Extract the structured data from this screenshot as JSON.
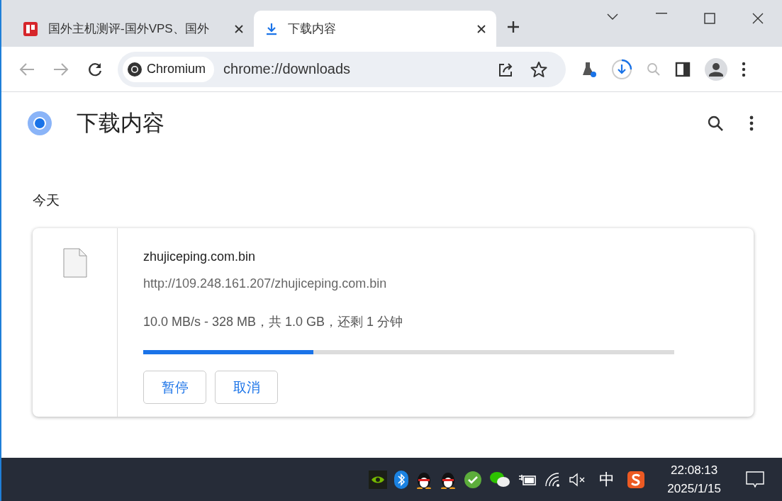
{
  "tabs": [
    {
      "title": "国外主机测评-国外VPS、国外",
      "selected": false,
      "kind": "site"
    },
    {
      "title": "下载内容",
      "selected": true,
      "kind": "download"
    }
  ],
  "toolbar": {
    "origin_chip": "Chromium",
    "url": "chrome://downloads"
  },
  "page": {
    "title": "下载内容",
    "section": "今天",
    "download": {
      "filename": "zhujiceping.com.bin",
      "url": "http://109.248.161.207/zhujiceping.com.bin",
      "status": "10.0 MB/s - 328 MB，共 1.0 GB，还剩 1 分钟",
      "level": 0.32,
      "buttons": [
        "暂停",
        "取消"
      ]
    }
  },
  "taskbar": {
    "ime": "中",
    "time": "22:08:13",
    "date": "2025/1/15"
  }
}
